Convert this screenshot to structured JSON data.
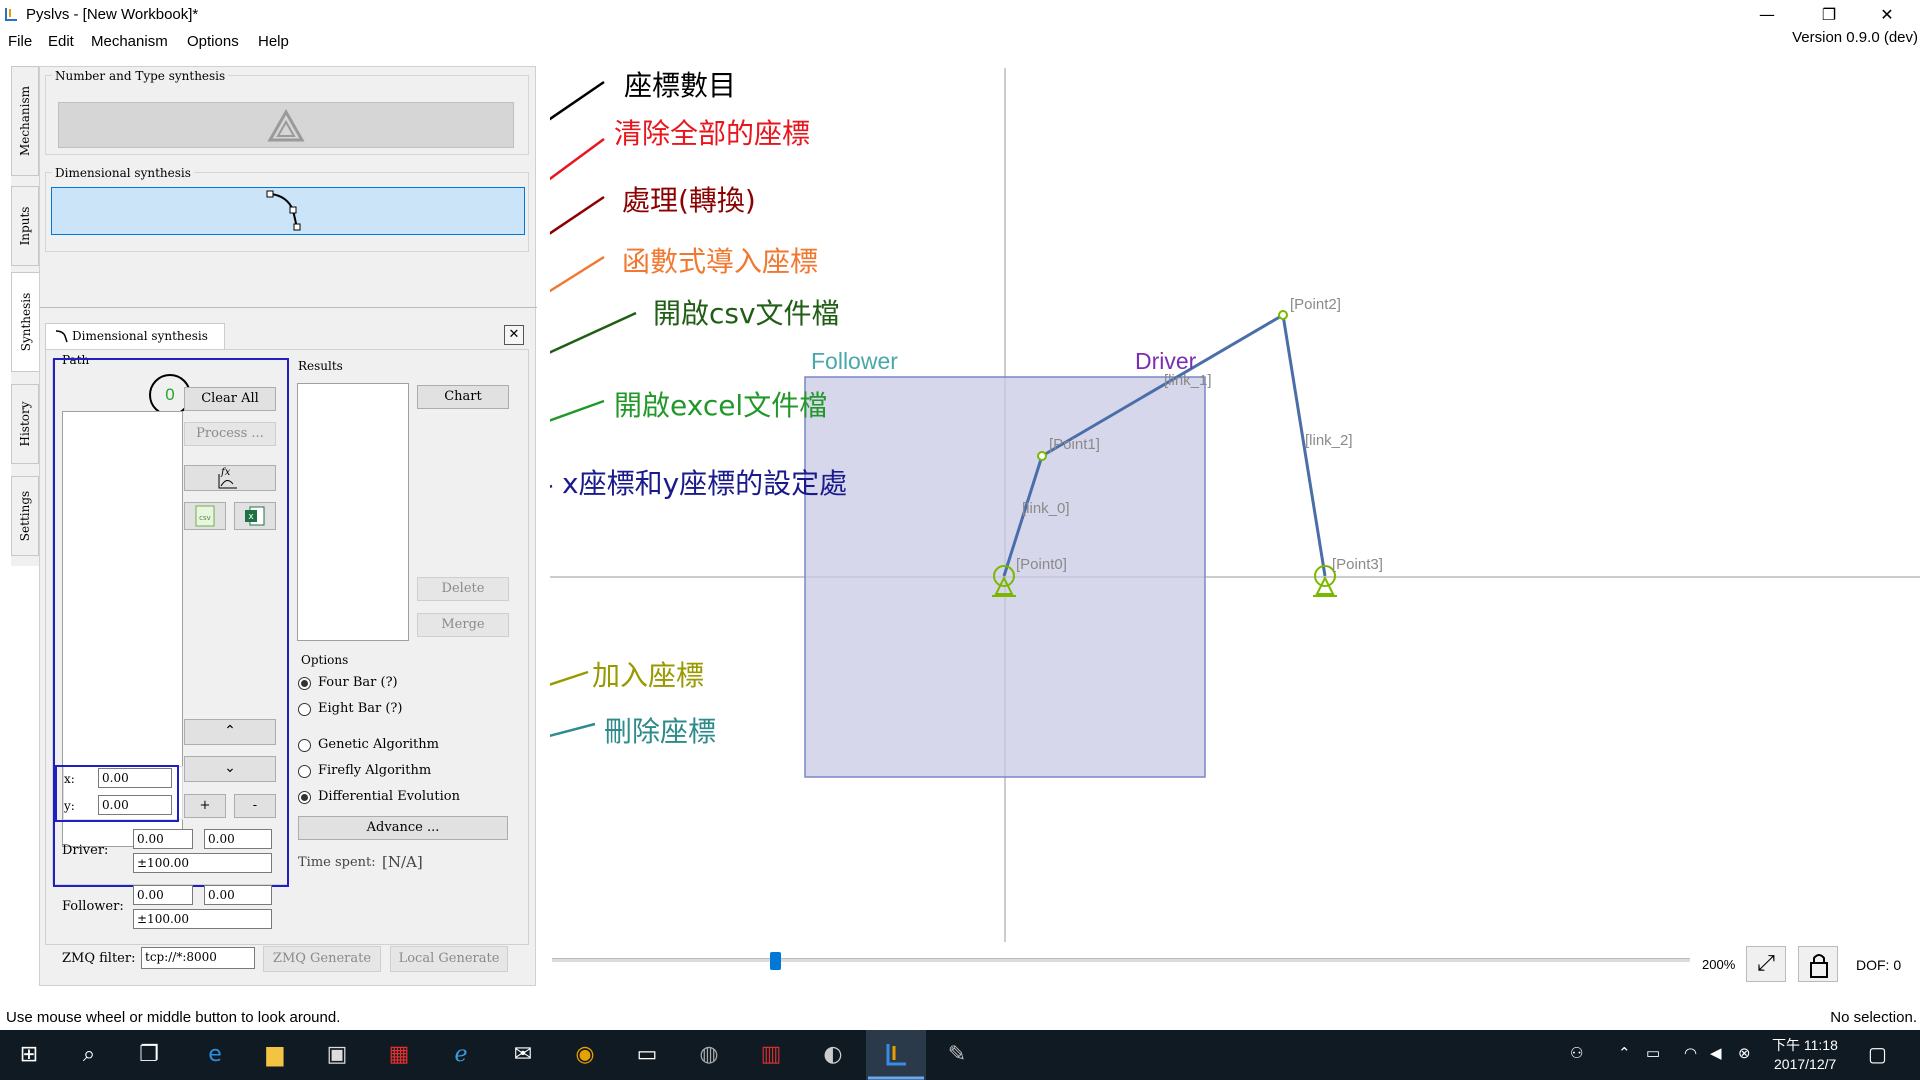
{
  "window": {
    "title": "Pyslvs - [New Workbook]*",
    "version": "Version 0.9.0 (dev)",
    "minimize": "—",
    "restore": "❐",
    "close": "✕"
  },
  "menu": [
    "File",
    "Edit",
    "Mechanism",
    "Options",
    "Help"
  ],
  "side_tabs": [
    "Mechanism",
    "Inputs",
    "Synthesis",
    "History",
    "Settings"
  ],
  "panel": {
    "number_type_title": "Number and Type synthesis",
    "dimensional_title": "Dimensional synthesis",
    "tab_label": "Dimensional synthesis",
    "path_title": "Path",
    "path_count": "0",
    "clear_all": "Clear All",
    "process": "Process ...",
    "fx_label": "fx",
    "x_label": "x:",
    "y_label": "y:",
    "x_value": "0.00",
    "y_value": "0.00",
    "add": "+",
    "remove": "-",
    "driver_label": "Driver:",
    "driver_x": "0.00",
    "driver_y": "0.00",
    "driver_r": "±100.00",
    "follower_label": "Follower:",
    "follower_x": "0.00",
    "follower_y": "0.00",
    "follower_r": "±100.00",
    "zmq_label": "ZMQ filter:",
    "zmq_value": "tcp://*:8000",
    "zmq_generate": "ZMQ Generate",
    "local_generate": "Local Generate",
    "results_title": "Results",
    "chart": "Chart",
    "delete": "Delete",
    "merge": "Merge",
    "options_title": "Options",
    "four_bar": "Four Bar (?)",
    "eight_bar": "Eight Bar (?)",
    "genetic": "Genetic Algorithm",
    "firefly": "Firefly Algorithm",
    "differential": "Differential Evolution",
    "advance": "Advance ...",
    "time_label": "Time spent:",
    "time_value": "[N/A]"
  },
  "canvas": {
    "follower_label": "Follower",
    "driver_label": "Driver",
    "points": [
      "[Point0]",
      "[Point1]",
      "[Point2]",
      "[Point3]"
    ],
    "links": [
      "[link_0]",
      "[link_1]",
      "[link_2]"
    ],
    "zoom": "200%",
    "dof": "DOF: 0"
  },
  "annotations": [
    {
      "text": "座標數目",
      "color": "#000000"
    },
    {
      "text": "清除全部的座標",
      "color": "#e8161c"
    },
    {
      "text": "處理(轉換)",
      "color": "#8b0000"
    },
    {
      "text": "函數式導入座標",
      "color": "#f07830"
    },
    {
      "text": "開啟csv文件檔",
      "color": "#1f5e14"
    },
    {
      "text": "開啟excel文件檔",
      "color": "#22982a"
    },
    {
      "text": "x座標和y座標的設定處",
      "color": "#1a1a8c"
    },
    {
      "text": "加入座標",
      "color": "#999900"
    },
    {
      "text": "刪除座標",
      "color": "#2e8b8b"
    }
  ],
  "status": {
    "left": "Use mouse wheel or middle button to look around.",
    "right": "No selection."
  },
  "taskbar": {
    "time": "下午 11:18",
    "date": "2017/12/7"
  }
}
